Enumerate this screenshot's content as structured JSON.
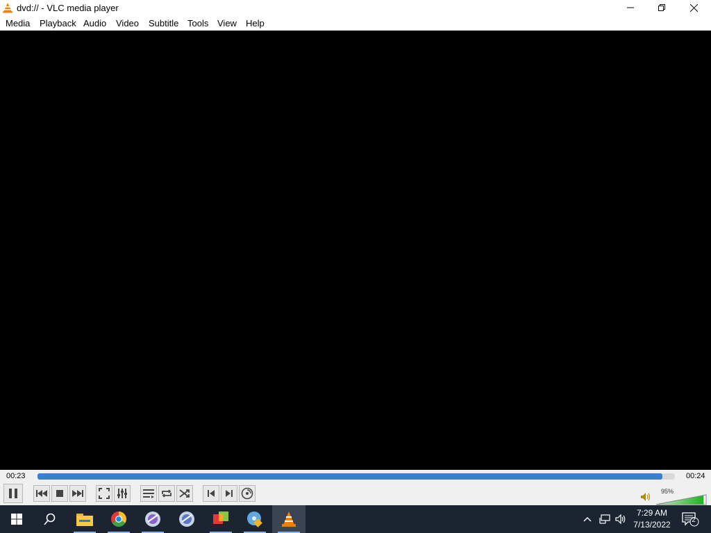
{
  "window": {
    "title": "dvd:// - VLC media player",
    "accent_color": "#f08000"
  },
  "menu": [
    "Media",
    "Playback",
    "Audio",
    "Video",
    "Subtitle",
    "Tools",
    "View",
    "Help"
  ],
  "player": {
    "elapsed": "00:23",
    "total": "00:24",
    "progress": 0.98,
    "volume_label": "95%",
    "volume_level": 0.95,
    "seek_color": "#3a7ed1",
    "volume_color": "#1db31d"
  },
  "control_icons": [
    "pause-icon",
    "previous-icon",
    "stop-icon",
    "next-icon",
    "fullscreen-icon",
    "extended-settings-icon",
    "playlist-icon",
    "loop-icon",
    "shuffle-icon",
    "previous-frame-icon",
    "next-frame-icon",
    "dvd-menu-icon"
  ],
  "taskbar": {
    "apps": [
      "start-icon",
      "search-icon",
      "file-explorer-icon",
      "chrome-icon",
      "app-icon",
      "app-icon",
      "app-icon",
      "app-icon",
      "vlc-icon"
    ],
    "time": "7:29 AM",
    "date": "7/13/2022",
    "notification_count": "2",
    "background": "#1c2432"
  }
}
